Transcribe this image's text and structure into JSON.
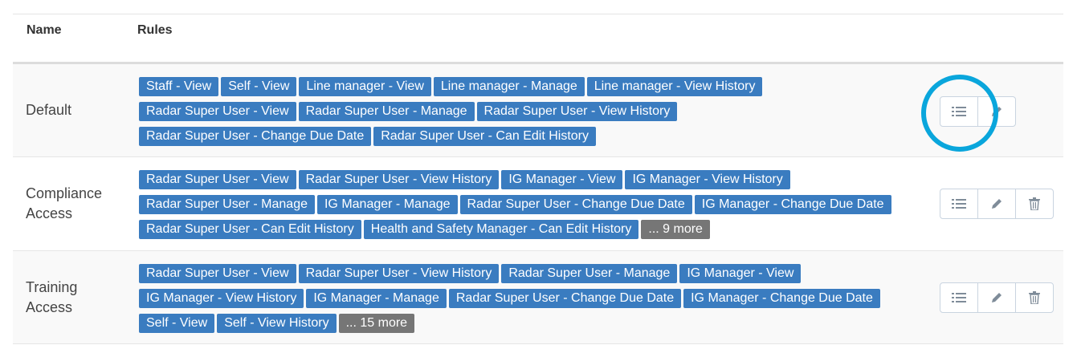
{
  "header": {
    "name_label": "Name",
    "rules_label": "Rules"
  },
  "rows": [
    {
      "name": "Default",
      "lines": [
        [
          "Staff - View",
          "Self - View",
          "Line manager - View",
          "Line manager - Manage",
          "Line manager - View History"
        ],
        [
          "Radar Super User - View",
          "Radar Super User - Manage",
          "Radar Super User - View History"
        ],
        [
          "Radar Super User - Change Due Date",
          "Radar Super User - Can Edit History"
        ]
      ],
      "more": ""
    },
    {
      "name": "Compliance Access",
      "lines": [
        [
          "Radar Super User - View",
          "Radar Super User - View History",
          "IG Manager - View",
          "IG Manager - View History"
        ],
        [
          "Radar Super User - Manage",
          "IG Manager - Manage",
          "Radar Super User - Change Due Date",
          "IG Manager - Change Due Date"
        ],
        [
          "Radar Super User - Can Edit History",
          "Health and Safety Manager - Can Edit History"
        ]
      ],
      "more": "... 9 more"
    },
    {
      "name": "Training Access",
      "lines": [
        [
          "Radar Super User - View",
          "Radar Super User - View History",
          "Radar Super User - Manage",
          "IG Manager - View"
        ],
        [
          "IG Manager - View History",
          "IG Manager - Manage",
          "Radar Super User - Change Due Date",
          "IG Manager - Change Due Date"
        ],
        [
          "Self - View",
          "Self - View History"
        ]
      ],
      "more": "... 15 more"
    }
  ],
  "icons": {
    "view_rules": "list-icon",
    "edit": "pencil-icon",
    "delete": "trash-icon"
  },
  "colors": {
    "tag": "#3a7cc0",
    "more_tag": "#767676",
    "highlight": "#0aa6dc"
  }
}
